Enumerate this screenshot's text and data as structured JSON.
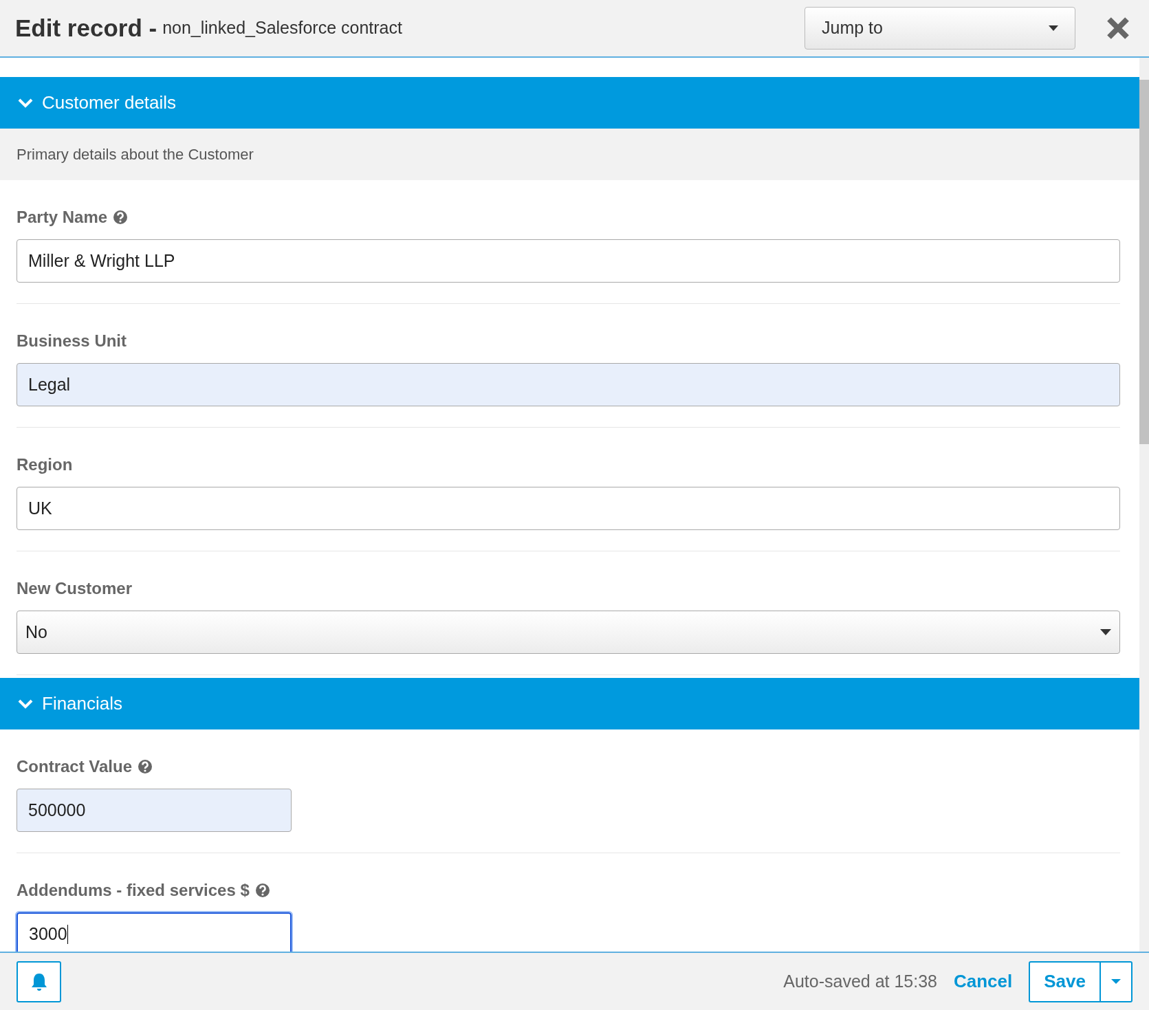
{
  "header": {
    "title": "Edit record -",
    "record_name": "non_linked_Salesforce contract",
    "jump_to": "Jump to"
  },
  "sections": [
    {
      "title": "Customer details",
      "expanded": true,
      "description": "Primary details about the Customer",
      "fields": [
        {
          "kind": "text",
          "label": "Party Name",
          "help": true,
          "value": "Miller & Wright LLP",
          "highlighted": false,
          "focused": false
        },
        {
          "kind": "text",
          "label": "Business Unit",
          "help": false,
          "value": "Legal",
          "highlighted": true,
          "focused": false
        },
        {
          "kind": "text",
          "label": "Region",
          "help": false,
          "value": "UK",
          "highlighted": false,
          "focused": false
        },
        {
          "kind": "select",
          "label": "New Customer",
          "help": false,
          "value": "No",
          "highlighted": false,
          "focused": false
        }
      ]
    },
    {
      "title": "Financials",
      "expanded": true,
      "fields": [
        {
          "kind": "number",
          "label": "Contract Value",
          "help": true,
          "value": "500000",
          "highlighted": true,
          "focused": false
        },
        {
          "kind": "number",
          "label": "Addendums - fixed services $",
          "help": true,
          "value": "3000",
          "highlighted": false,
          "focused": true
        }
      ]
    }
  ],
  "footer": {
    "autosave": "Auto-saved at 15:38",
    "cancel": "Cancel",
    "save": "Save"
  }
}
